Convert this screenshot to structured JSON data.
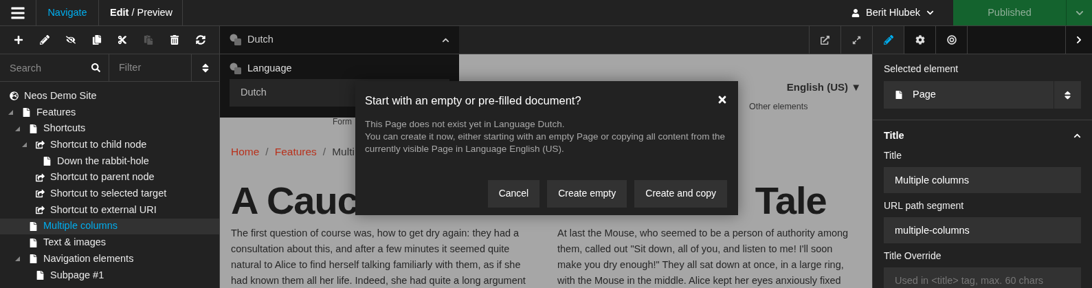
{
  "top_bar": {
    "tabs": [
      {
        "label": "Navigate",
        "selected": true
      },
      {
        "label": "**Edit** / Preview",
        "selected": false
      }
    ],
    "user": "Berit Hlubek",
    "publish": {
      "label": "Published",
      "disabled": true
    }
  },
  "sidebar": {
    "toolbar": [
      {
        "kind": "add",
        "disabled": false
      },
      {
        "kind": "edit",
        "disabled": false
      },
      {
        "kind": "hide",
        "disabled": false
      },
      {
        "kind": "copy",
        "disabled": false
      },
      {
        "kind": "cut",
        "disabled": false
      },
      {
        "kind": "paste",
        "disabled": true
      },
      {
        "kind": "delete",
        "disabled": false
      },
      {
        "kind": "refresh",
        "disabled": false
      }
    ],
    "search": {
      "placeholder": "Search"
    },
    "filter": {
      "placeholder": "Filter"
    },
    "tree": [
      {
        "label": "Neos Demo Site",
        "kind": "site",
        "selected": false,
        "children": [
          {
            "label": "Features",
            "kind": "page",
            "selected": false,
            "expanded": true,
            "children": [
              {
                "label": "Shortcuts",
                "kind": "page",
                "selected": false,
                "expanded": true,
                "children": [
                  {
                    "label": "Shortcut to child node",
                    "kind": "shortcut",
                    "selected": false,
                    "expanded": true,
                    "children": [
                      {
                        "label": "Down the rabbit-hole",
                        "kind": "page",
                        "selected": false
                      }
                    ]
                  },
                  {
                    "label": "Shortcut to parent node",
                    "kind": "shortcut",
                    "selected": false
                  },
                  {
                    "label": "Shortcut to selected target",
                    "kind": "shortcut",
                    "selected": false
                  },
                  {
                    "label": "Shortcut to external URI",
                    "kind": "shortcut",
                    "selected": false
                  }
                ]
              },
              {
                "label": "Multiple columns",
                "kind": "page",
                "selected": true
              },
              {
                "label": "Text & images",
                "kind": "page",
                "selected": false
              },
              {
                "label": "Navigation elements",
                "kind": "page",
                "selected": false,
                "expanded": true,
                "children": [
                  {
                    "label": "Subpage #1",
                    "kind": "page",
                    "selected": false
                  }
                ]
              }
            ]
          }
        ]
      }
    ]
  },
  "dimension": {
    "value": "Dutch",
    "expanded": true,
    "label": "Language",
    "select_value": "Dutch"
  },
  "preview": {
    "language": "English (US) ▼",
    "nav_right": "Other elements",
    "nav_left": "Form",
    "breadcrumb": [
      {
        "label": "Home",
        "kind": "link"
      },
      {
        "label": "Features",
        "kind": "link"
      },
      {
        "label": "Multi",
        "kind": "current"
      }
    ],
    "separator": "/",
    "heading_left": "A Cauc",
    "heading_right": "Tale",
    "columns": [
      "The first question of course was, how to get dry again: they had a\nconsultation about this, and after a few minutes it seemed quite\nnatural to Alice to find herself talking familiarly with them, as if she\nhad known them all her life. Indeed, she had quite a long argument",
      "At last the Mouse, who seemed to be a person of authority among\nthem, called out \"Sit down, all of you, and listen to me! I'll soon\nmake you dry enough!\" They all sat down at once, in a large ring,\nwith the Mouse in the middle. Alice kept her eyes anxiously fixed"
    ]
  },
  "dialog": {
    "title": "Start with an empty or pre-filled document?",
    "body": [
      "This Page does not exist yet in Language Dutch.",
      "You can create it now, either starting with an empty Page or copying all content from the currently visible Page in Language English (US)."
    ],
    "buttons": [
      "Cancel",
      "Create empty",
      "Create and copy"
    ]
  },
  "inspector": {
    "tabs": [
      {
        "kind": "edit",
        "selected": true
      },
      {
        "kind": "settings",
        "selected": false
      },
      {
        "kind": "target",
        "selected": false
      }
    ],
    "selected_label": "Selected element",
    "selected_value": "Page",
    "section": {
      "title": "Title",
      "expanded": true
    },
    "fields": [
      {
        "label": "Title",
        "value": "Multiple columns"
      },
      {
        "label": "URL path segment",
        "value": "multiple-columns"
      },
      {
        "label": "Title Override",
        "placeholder": "Used in <title> tag, max. 60 chars"
      }
    ]
  }
}
